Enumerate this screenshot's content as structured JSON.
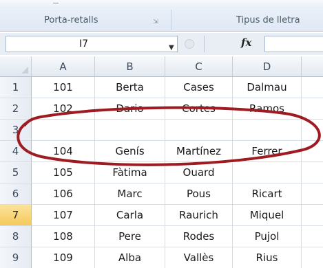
{
  "ribbon": {
    "group_clipboard": "Porta-retalls",
    "group_font": "Tipus de lletra"
  },
  "formula_bar": {
    "name_box_value": "I7",
    "formula_value": ""
  },
  "sheet": {
    "columns": [
      "A",
      "B",
      "C",
      "D"
    ],
    "active_row": "7",
    "rows": [
      {
        "num": "1",
        "cells": [
          "101",
          "Berta",
          "Cases",
          "Dalmau"
        ]
      },
      {
        "num": "2",
        "cells": [
          "102",
          "Dario",
          "Cortes",
          "Ramos"
        ]
      },
      {
        "num": "3",
        "cells": [
          "",
          "",
          "",
          ""
        ]
      },
      {
        "num": "4",
        "cells": [
          "104",
          "Genís",
          "Martínez",
          "Ferrer"
        ]
      },
      {
        "num": "5",
        "cells": [
          "105",
          "Fàtima",
          "Ouard",
          ""
        ]
      },
      {
        "num": "6",
        "cells": [
          "106",
          "Marc",
          "Pous",
          "Ricart"
        ]
      },
      {
        "num": "7",
        "cells": [
          "107",
          "Carla",
          "Raurich",
          "Miquel"
        ]
      },
      {
        "num": "8",
        "cells": [
          "108",
          "Pere",
          "Rodes",
          "Pujol"
        ]
      },
      {
        "num": "9",
        "cells": [
          "109",
          "Alba",
          "Vallès",
          "Rius"
        ]
      }
    ]
  },
  "colors": {
    "annotation": "#9e1b22",
    "active_row_header": "#f5c95c"
  }
}
